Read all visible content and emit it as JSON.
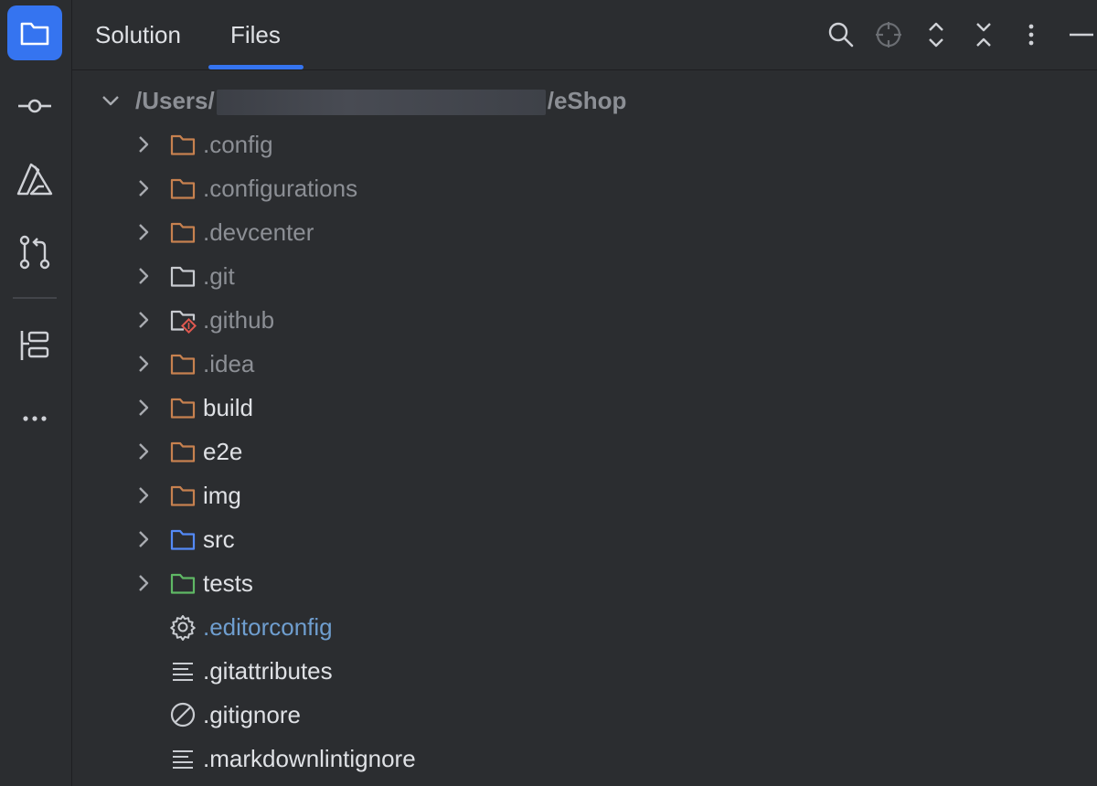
{
  "tabs": [
    {
      "label": "Solution",
      "active": false
    },
    {
      "label": "Files",
      "active": true
    }
  ],
  "colors": {
    "accent": "#3574f0",
    "folder_excluded": "#c7814f",
    "folder_source": "#548af7",
    "folder_test": "#5fb865",
    "text_dim": "#8c8f95",
    "text_link": "#6f9ecf"
  },
  "root": {
    "prefix": "/Users/",
    "suffix": "/eShop",
    "expanded": true
  },
  "tree": [
    {
      "label": ".config",
      "icon": "folder-orange-icon",
      "expandable": true
    },
    {
      "label": ".configurations",
      "icon": "folder-orange-icon",
      "expandable": true
    },
    {
      "label": ".devcenter",
      "icon": "folder-orange-icon",
      "expandable": true
    },
    {
      "label": ".git",
      "icon": "folder-gray-icon",
      "expandable": true
    },
    {
      "label": ".github",
      "icon": "folder-github-icon",
      "expandable": true
    },
    {
      "label": ".idea",
      "icon": "folder-orange-icon",
      "expandable": true
    },
    {
      "label": "build",
      "icon": "folder-orange-icon",
      "expandable": true
    },
    {
      "label": "e2e",
      "icon": "folder-orange-icon",
      "expandable": true
    },
    {
      "label": "img",
      "icon": "folder-orange-icon",
      "expandable": true
    },
    {
      "label": "src",
      "icon": "folder-blue-icon",
      "expandable": true
    },
    {
      "label": "tests",
      "icon": "folder-green-icon",
      "expandable": true
    },
    {
      "label": ".editorconfig",
      "icon": "gear-icon",
      "expandable": false
    },
    {
      "label": ".gitattributes",
      "icon": "text-file-icon",
      "expandable": false
    },
    {
      "label": ".gitignore",
      "icon": "ignore-file-icon",
      "expandable": false
    },
    {
      "label": ".markdownlintignore",
      "icon": "text-file-icon",
      "expandable": false
    }
  ]
}
